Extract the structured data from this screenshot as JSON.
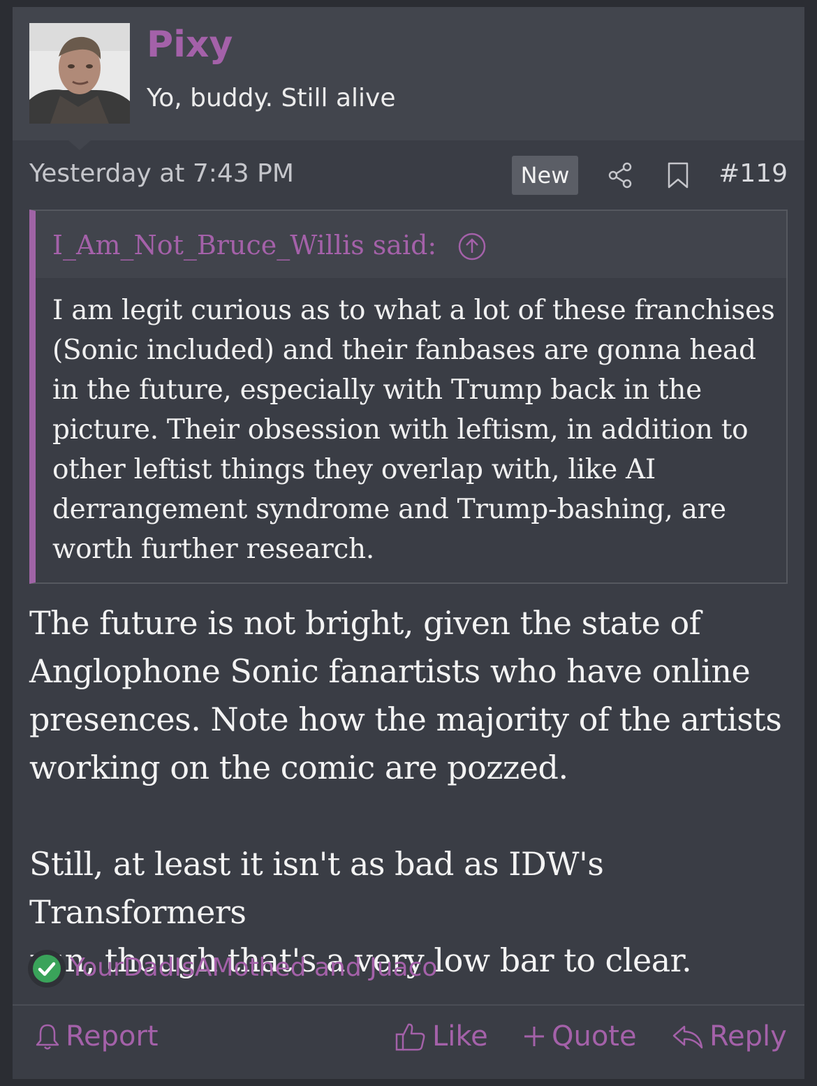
{
  "author": {
    "name": "Pixy",
    "title": "Yo, buddy. Still alive"
  },
  "post": {
    "date": "Yesterday at 7:43 PM",
    "badge": "New",
    "number": "#119"
  },
  "quote": {
    "author": "I_Am_Not_Bruce_Willis said:",
    "body": "I am legit curious as to what a lot of these franchises\n(Sonic included) and their fanbases are gonna head\nin the future, especially with Trump back in the\npicture. Their obsession with leftism, in addition to\nother leftist things they overlap with, like AI\nderrangement syndrome and Trump-bashing, are\nworth further research."
  },
  "body": {
    "paragraph_1": "The future is not bright, given the state of\nAnglophone Sonic fanartists who have online\npresences. Note how the majority of the artists\nworking on the comic are pozzed.",
    "paragraph_2": "Still, at least it isn't as bad as IDW's Transformers\nrun, though that's a very low bar to clear."
  },
  "reactions": {
    "icon": "checkmark-icon",
    "users": "YourDadIsAMothed and Juaco"
  },
  "actions": {
    "report": "Report",
    "like": "Like",
    "quote": "Quote",
    "reply": "Reply"
  },
  "colors": {
    "accent": "#a461a9",
    "background": "#3a3d45",
    "header": "#42454d",
    "reaction_green": "#3aa35a"
  }
}
